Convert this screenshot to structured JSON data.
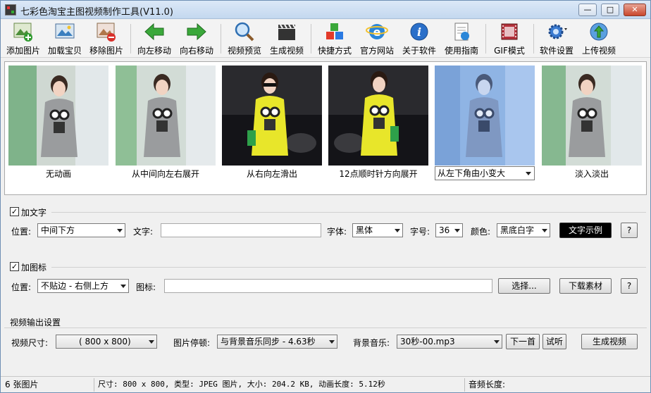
{
  "window": {
    "title": "七彩色淘宝主图视频制作工具(V11.0)"
  },
  "toolbar": [
    {
      "label": "添加图片",
      "icon": "add-image-icon"
    },
    {
      "label": "加载宝贝",
      "icon": "load-product-icon"
    },
    {
      "label": "移除图片",
      "icon": "remove-image-icon"
    },
    {
      "label": "向左移动",
      "icon": "arrow-left-icon"
    },
    {
      "label": "向右移动",
      "icon": "arrow-right-icon"
    },
    {
      "label": "视频预览",
      "icon": "magnifier-icon"
    },
    {
      "label": "生成视频",
      "icon": "clapper-icon"
    },
    {
      "label": "快捷方式",
      "icon": "cubes-icon"
    },
    {
      "label": "官方网站",
      "icon": "ie-icon"
    },
    {
      "label": "关于软件",
      "icon": "info-icon"
    },
    {
      "label": "使用指南",
      "icon": "guide-icon"
    },
    {
      "label": "GIF模式",
      "icon": "film-icon"
    },
    {
      "label": "软件设置",
      "icon": "gear-icon"
    },
    {
      "label": "上传视频",
      "icon": "upload-icon"
    }
  ],
  "gallery": {
    "items": [
      {
        "caption": "无动画",
        "style": "grey"
      },
      {
        "caption": "从中间向左右展开",
        "style": "grey"
      },
      {
        "caption": "从右向左滑出",
        "style": "yellow"
      },
      {
        "caption": "12点顺时针方向展开",
        "style": "yellow"
      },
      {
        "caption": "从左下角由小变大",
        "style": "blue",
        "selected": true
      },
      {
        "caption": "淡入淡出",
        "style": "grey"
      }
    ]
  },
  "text_section": {
    "checkbox_label": "加文字",
    "checked": true,
    "position_label": "位置:",
    "position_value": "中间下方",
    "text_label": "文字:",
    "text_value": "",
    "font_label": "字体:",
    "font_value": "黑体",
    "size_label": "字号:",
    "size_value": "36",
    "color_label": "颜色:",
    "color_value": "黑底白字",
    "sample_button": "文字示例",
    "help_button": "?"
  },
  "logo_section": {
    "checkbox_label": "加图标",
    "checked": true,
    "position_label": "位置:",
    "position_value": "不贴边 - 右侧上方",
    "icon_label": "图标:",
    "icon_value": "",
    "choose_button": "选择...",
    "download_button": "下载素材",
    "help_button": "?"
  },
  "output_section": {
    "title": "视频输出设置",
    "size_label": "视频尺寸:",
    "size_value": "( 800 x  800)",
    "pause_label": "图片停顿:",
    "pause_value": "与背景音乐同步 - 4.63秒",
    "music_label": "背景音乐:",
    "music_value": "30秒-00.mp3",
    "next_button": "下一首",
    "listen_button": "试听",
    "generate_button": "生成视频"
  },
  "statusbar": {
    "count": "6 张图片",
    "info": "尺寸: 800 x 800, 类型: JPEG 图片, 大小: 204.2 KB, 动画长度: 5.12秒",
    "audio": "音频长度:"
  },
  "colors": {
    "accent": "#6f8fb4",
    "sample_bg": "#000000"
  }
}
